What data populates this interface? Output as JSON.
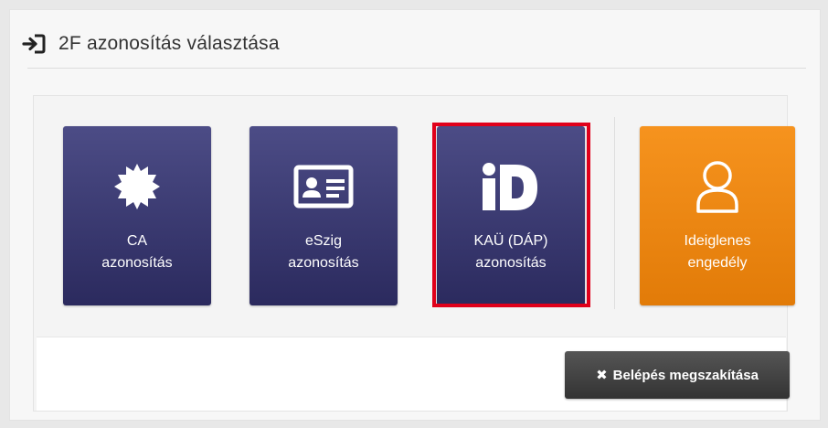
{
  "header": {
    "title": "2F azonosítás választása",
    "icon": "sign-in-icon"
  },
  "tiles": [
    {
      "line1": "CA",
      "line2": "azonosítás",
      "icon": "certificate-badge-icon"
    },
    {
      "line1": "eSzig",
      "line2": "azonosítás",
      "icon": "id-card-icon"
    },
    {
      "line1": "KAÜ (DÁP)",
      "line2": "azonosítás",
      "icon": "id-logo-icon"
    },
    {
      "line1": "Ideiglenes",
      "line2": "engedély",
      "icon": "user-icon"
    }
  ],
  "selected_tile": "KAÜ (DÁP)",
  "footer": {
    "cancel_label": "Belépés megszakítása",
    "cancel_icon": "close-icon"
  },
  "colors": {
    "tile_dark": "#2f2e66",
    "tile_orange": "#f08a12",
    "selected_border": "#e0001a",
    "button_dark": "#444444"
  }
}
